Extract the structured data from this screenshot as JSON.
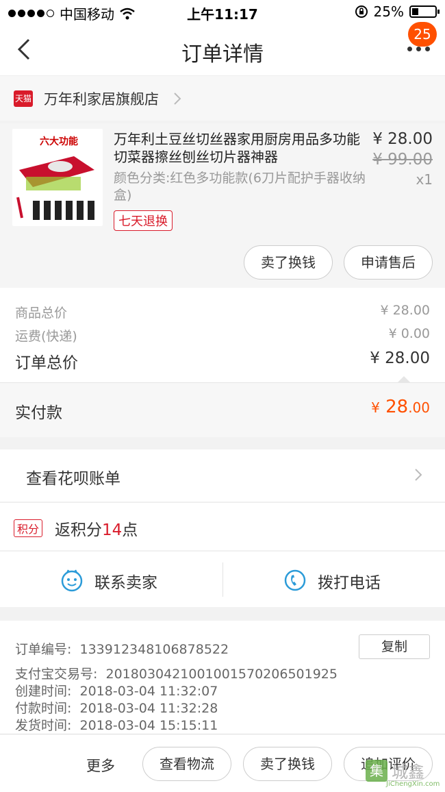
{
  "status": {
    "carrier": "中国移动",
    "time": "上午11:17",
    "battery": "25%"
  },
  "nav": {
    "title": "订单详情",
    "badge": "25"
  },
  "store": {
    "name": "万年利家居旗舰店",
    "logo_text": "天猫"
  },
  "item": {
    "thumb_label": "六大功能",
    "title": "万年利土豆丝切丝器家用厨房用品多功能切菜器擦丝刨丝切片器神器",
    "variant": "颜色分类:红色多功能款(6刀片配护手器收纳盒)",
    "tag": "七天退换",
    "price": "¥ 28.00",
    "original_price": "¥ 99.00",
    "qty": "x1",
    "btn_sell": "卖了换钱",
    "btn_aftersale": "申请售后"
  },
  "summary": {
    "goods_label": "商品总价",
    "goods_value": "¥ 28.00",
    "ship_label": "运费(快递)",
    "ship_value": "¥ 0.00",
    "total_label": "订单总价",
    "total_value": "¥ 28.00",
    "paid_label": "实付款",
    "paid_symbol": "¥",
    "paid_int": "28",
    "paid_dec": ".00"
  },
  "huabei": {
    "label": "查看花呗账单"
  },
  "points": {
    "tag": "积分",
    "prefix": "返积分",
    "value": "14",
    "suffix": "点"
  },
  "contact": {
    "seller": "联系卖家",
    "phone": "拨打电话"
  },
  "info": {
    "order_no_label": "订单编号:",
    "order_no": "133912348106878522",
    "copy": "复制",
    "alipay_label": "支付宝交易号:",
    "alipay_no": "2018030421001001570206501925",
    "created_label": "创建时间:",
    "created": "2018-03-04 11:32:07",
    "paid_label": "付款时间:",
    "paid": "2018-03-04 11:32:28",
    "shipped_label": "发货时间:",
    "shipped": "2018-03-04 15:15:11"
  },
  "bottom": {
    "more": "更多",
    "logistics": "查看物流",
    "sell": "卖了换钱",
    "review": "追加评价"
  },
  "watermark": {
    "icon_text": "集",
    "text": "城鑫",
    "sub": "JiChengXin.com"
  },
  "colors": {
    "accent": "#ff5000",
    "tmall_red": "#d91b2a",
    "contact_blue": "#2b9bd8"
  }
}
